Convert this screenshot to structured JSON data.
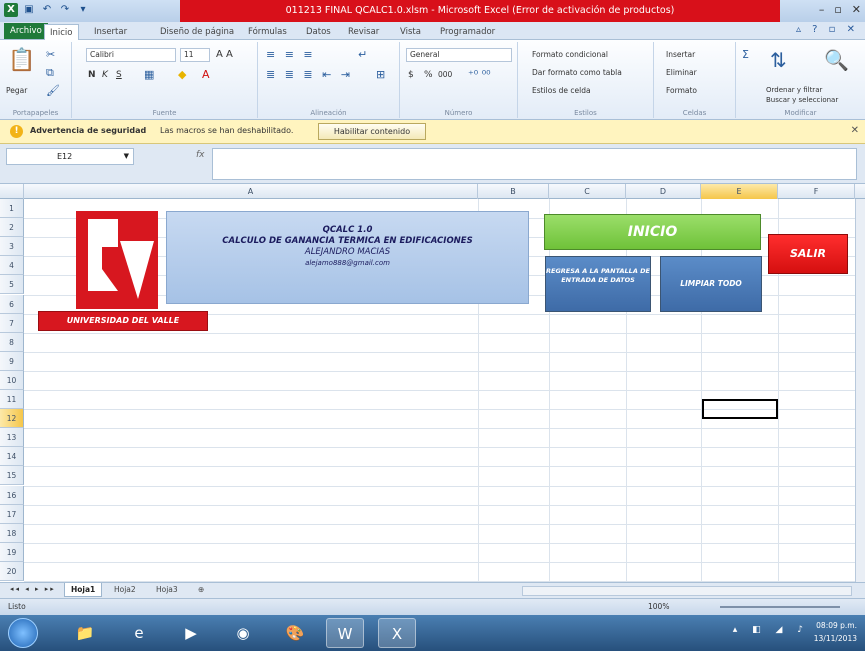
{
  "window": {
    "title": "011213 FINAL QCALC1.0.xlsm  -  Microsoft Excel (Error de activación de productos)",
    "controls": [
      "–",
      "▫",
      "✕"
    ]
  },
  "ribbon_tabs": [
    "Archivo",
    "Inicio",
    "Insertar",
    "Diseño de página",
    "Fórmulas",
    "Datos",
    "Revisar",
    "Vista",
    "Programador"
  ],
  "ribbon": {
    "clipboard": {
      "paste": "Pegar",
      "label": "Portapapeles"
    },
    "font": {
      "name": "Calibri",
      "size": "11",
      "bold": "N",
      "italic": "K",
      "underline": "S",
      "label": "Fuente"
    },
    "alignment": {
      "label": "Alineación"
    },
    "number": {
      "format": "General",
      "currency": "$",
      "percent": "%",
      "thousands": "000",
      "label": "Número"
    },
    "styles": {
      "conditional": "Formato condicional",
      "table": "Dar formato como tabla",
      "cell": "Estilos de celda",
      "label": "Estilos"
    },
    "cells": {
      "insert": "Insertar",
      "delete": "Eliminar",
      "format": "Formato",
      "label": "Celdas"
    },
    "editing": {
      "sort": "Ordenar y filtrar",
      "find": "Buscar y seleccionar",
      "label": "Modificar"
    }
  },
  "security_bar": {
    "title": "Advertencia de seguridad",
    "message": "Las macros se han deshabilitado.",
    "enable_button": "Habilitar contenido",
    "close": "✕"
  },
  "formula_bar": {
    "name_box": "E12",
    "fx": "fx",
    "content": ""
  },
  "columns": [
    "A",
    "B",
    "C",
    "D",
    "E",
    "F"
  ],
  "selected_column": "E",
  "rows": [
    "1",
    "2",
    "3",
    "4",
    "5",
    "6",
    "7",
    "8",
    "9",
    "10",
    "11",
    "12",
    "13",
    "14",
    "15",
    "16",
    "17",
    "18",
    "19",
    "20"
  ],
  "selected_row": "12",
  "sheet": {
    "logo_caption": "UNIVERSIDAD DEL VALLE",
    "info": {
      "line1": "QCALC 1.0",
      "line2": "CALCULO DE GANANCIA TERMICA EN EDIFICACIONES",
      "line3": "ALEJANDRO MACIAS",
      "line4": "alejamo888@gmail.com"
    },
    "buttons": {
      "inicio": "INICIO",
      "salir": "SALIR",
      "regresa": "REGRESA A LA PANTALLA DE ENTRADA DE DATOS",
      "limpiar": "LIMPIAR TODO"
    }
  },
  "sheet_tabs": [
    "Hoja1",
    "Hoja2",
    "Hoja3"
  ],
  "status": {
    "mode": "Listo",
    "zoom": "100%"
  },
  "taskbar": {
    "apps": [
      "explorer-icon",
      "ie-icon",
      "media-icon",
      "chrome-icon",
      "paint-icon",
      "word-icon",
      "excel-icon"
    ],
    "time": "08:09 p.m.",
    "date": "13/11/2013"
  },
  "colors": {
    "accent_red": "#d7171f",
    "inicio_green": "#6fc239",
    "button_blue": "#3e6ba7",
    "excel_green": "#1f7a3a"
  }
}
